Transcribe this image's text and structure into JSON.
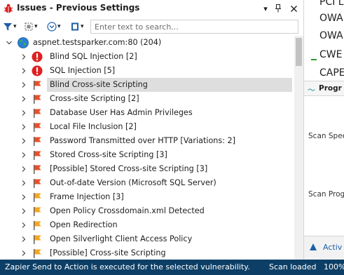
{
  "window": {
    "title": "Issues - Previous Settings"
  },
  "toolbar": {
    "search_placeholder": "Enter text to search..."
  },
  "tree": {
    "root_label": "aspnet.testsparker.com:80 (204)",
    "items": [
      {
        "label": "Blind SQL Injection [2]",
        "severity": "critical",
        "icon": "critical-exclamation-icon"
      },
      {
        "label": "SQL Injection [5]",
        "severity": "critical",
        "icon": "critical-exclamation-icon"
      },
      {
        "label": "Blind Cross-site Scripting",
        "severity": "high",
        "icon": "red-flag-icon",
        "selected": true
      },
      {
        "label": "Cross-site Scripting [2]",
        "severity": "high",
        "icon": "red-flag-icon"
      },
      {
        "label": "Database User Has Admin Privileges",
        "severity": "high",
        "icon": "red-flag-icon"
      },
      {
        "label": "Local File Inclusion [2]",
        "severity": "high",
        "icon": "red-flag-icon"
      },
      {
        "label": "Password Transmitted over HTTP [Variations: 2]",
        "severity": "high",
        "icon": "red-flag-icon"
      },
      {
        "label": "Stored Cross-site Scripting [3]",
        "severity": "high",
        "icon": "red-flag-icon"
      },
      {
        "label": "[Possible] Stored Cross-site Scripting [3]",
        "severity": "high",
        "icon": "red-flag-icon"
      },
      {
        "label": "Out-of-date Version (Microsoft SQL Server)",
        "severity": "high",
        "icon": "red-flag-icon"
      },
      {
        "label": "Frame Injection [3]",
        "severity": "medium",
        "icon": "orange-flag-icon"
      },
      {
        "label": "Open Policy Crossdomain.xml Detected",
        "severity": "medium",
        "icon": "orange-flag-icon"
      },
      {
        "label": "Open Redirection",
        "severity": "medium",
        "icon": "orange-flag-icon"
      },
      {
        "label": "Open Silverlight Client Access Policy",
        "severity": "medium",
        "icon": "orange-flag-icon"
      },
      {
        "label": "[Possible] Cross-site Scripting",
        "severity": "medium",
        "icon": "orange-flag-icon"
      }
    ]
  },
  "right_panel": {
    "list": [
      "PCI L",
      "OWA",
      "OWA",
      "CWE",
      "CAPE"
    ],
    "progress_title": "Progr",
    "scan_speed_label": "Scan Spee",
    "scan_progress_label": "Scan Prog",
    "active_label": "Activ"
  },
  "status_bar": {
    "message": "Zapier Send to Action is executed for the selected vulnerability.",
    "scan_state": "Scan loaded",
    "percent": "100%"
  },
  "colors": {
    "critical": "#e02020",
    "high_flag": "#e8502a",
    "medium_flag": "#f5a623",
    "status_bar": "#0d3f66",
    "selected_row": "#dedede",
    "accent_blue": "#1f5fa8"
  }
}
